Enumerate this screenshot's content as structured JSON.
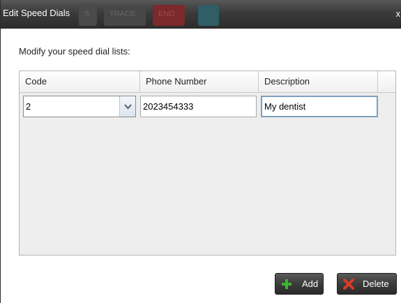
{
  "window": {
    "title": "Edit Speed Dials",
    "close_label": "x",
    "background_buttons": [
      "S",
      "TRACE",
      "END"
    ]
  },
  "instruction": "Modify your speed dial lists:",
  "table": {
    "headers": {
      "code": "Code",
      "phone": "Phone Number",
      "description": "Description"
    },
    "rows": [
      {
        "code": "2",
        "phone": "2023454333",
        "description": "My dentist"
      }
    ]
  },
  "buttons": {
    "add": "Add",
    "delete": "Delete"
  },
  "colors": {
    "add_icon": "#3cb52f",
    "delete_icon": "#d93a2a",
    "focus_border": "#7d9fbf",
    "titlebar": "#3a3a3a"
  },
  "icons": {
    "add": "plus-icon",
    "delete": "x-icon",
    "dropdown": "chevron-down-icon"
  }
}
